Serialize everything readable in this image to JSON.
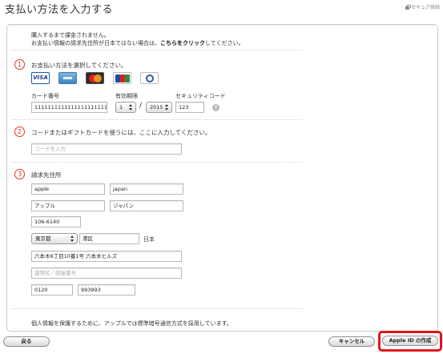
{
  "header": {
    "title": "支払い方法を入力する",
    "secure_label": "セキュア接続"
  },
  "intro": {
    "line1": "購入するまで課金されません。",
    "line2_prefix": "お支払い情報の請求先住所が日本ではない場合は、",
    "line2_link": "こちらをクリック",
    "line2_suffix": "してください。"
  },
  "payment": {
    "step": "1",
    "title": "お支払い方法を選択してください。",
    "cards": [
      {
        "name": "visa",
        "label": "VISA",
        "selected": true
      },
      {
        "name": "amex",
        "label": ""
      },
      {
        "name": "mastercard",
        "label": ""
      },
      {
        "name": "jcb",
        "label": ""
      },
      {
        "name": "diners",
        "label": ""
      }
    ],
    "card_number_label": "カード番号",
    "card_number_value": "1111111111111111111111",
    "expiry_label": "有効期限",
    "expiry_month": "1",
    "expiry_separator": "/",
    "expiry_year": "2015",
    "security_code_label": "セキュリティコード",
    "security_code_value": "123",
    "help_icon": "?"
  },
  "gift": {
    "step": "2",
    "title": "コードまたはギフトカードを使うには、ここに入力してください。",
    "code_placeholder": "コードを入力"
  },
  "billing": {
    "step": "3",
    "title": "請求先住所",
    "last_name": "apple",
    "first_name": "japan",
    "last_name_kana": "アップル",
    "first_name_kana": "ジャパン",
    "postal_code": "106-6140",
    "prefecture": "東京都",
    "city": "港区",
    "country": "日本",
    "street": "六本木6丁目10番1号 六本木ヒルズ",
    "building_placeholder": "建物名／部屋番号",
    "phone_area": "0120",
    "phone_number": "993993"
  },
  "footer": {
    "privacy_note": "個人情報を保護するために、アップルでは標準暗号通信方式を採用しています。",
    "back_button": "戻る",
    "cancel_button": "キャンセル",
    "create_button": "Apple ID の作成"
  },
  "colors": {
    "step_accent": "#e03a1e",
    "highlight": "#e4141b"
  }
}
